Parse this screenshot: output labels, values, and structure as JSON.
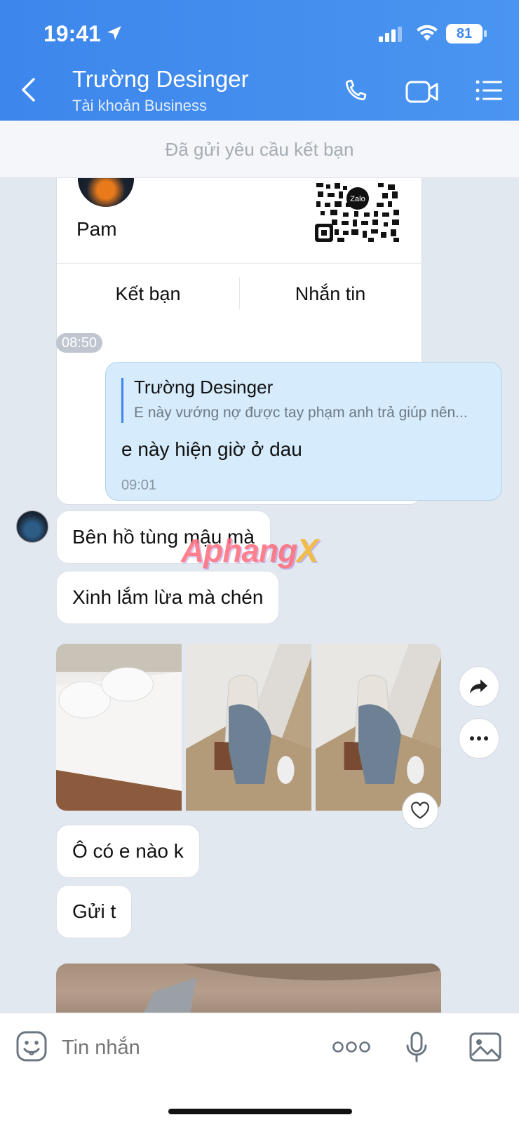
{
  "status_bar": {
    "time": "19:41",
    "battery": "81"
  },
  "header": {
    "contact_name": "Trường Desinger",
    "contact_subtitle": "Tài khoản Business"
  },
  "friend_request_banner": "Đã gửi yêu cầu kết bạn",
  "contact_card": {
    "name": "Pam",
    "qr_badge": "Zalo",
    "add_friend_label": "Kết bạn",
    "message_label": "Nhắn tin",
    "time": "08:50"
  },
  "sent_message": {
    "quote_author": "Trường Desinger",
    "quote_text": "E này vướng nợ được tay phạm anh trả giúp nên...",
    "text": "e này hiện giờ ở dau",
    "time": "09:01"
  },
  "received_messages": [
    "Bên hồ tùng mậu mà",
    "Xinh lắm lừa mà chén",
    "Ô có e nào k",
    "Gửi t"
  ],
  "watermark": {
    "main": "Aphang",
    "accent": "X"
  },
  "input": {
    "placeholder": "Tin nhắn"
  },
  "icons": {
    "back": "chevron-left-icon",
    "call": "phone-icon",
    "video": "video-camera-icon",
    "menu": "list-menu-icon",
    "share": "share-arrow-icon",
    "more": "more-dots-icon",
    "heart": "heart-icon",
    "emoji": "emoji-icon",
    "mic": "microphone-icon",
    "image": "image-icon"
  },
  "colors": {
    "header": "#3d86ec",
    "sent_bubble": "#d6ebfb",
    "chat_bg": "#e2e8f0"
  }
}
